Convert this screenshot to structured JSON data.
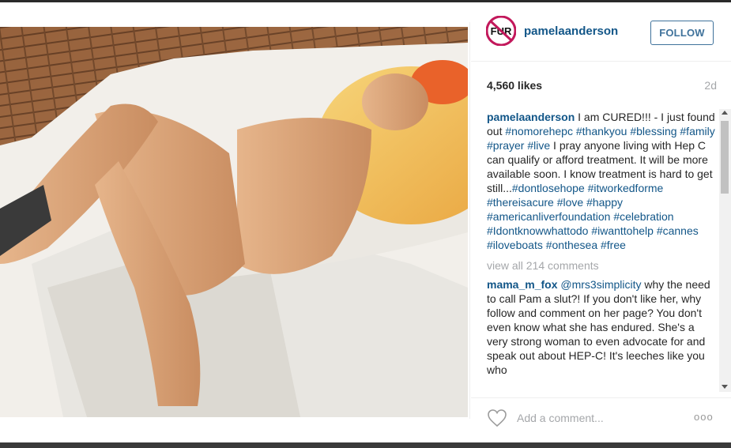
{
  "post": {
    "username": "pamelaanderson",
    "follow_label": "FOLLOW",
    "avatar_text": "FUR",
    "likes": "4,560 likes",
    "age": "2d",
    "caption_user": "pamelaanderson",
    "caption_text_1": " I am CURED!!! - I just found out ",
    "caption_tags_1": "#nomorehepc #thankyou #blessing #family #prayer #live",
    "caption_text_2": " I pray anyone living with Hep C can qualify or afford treatment. It will be more available soon. I know treatment is hard to get still...",
    "caption_tags_2": "#dontlosehope #itworkedforme #thereisacure #love #happy #americanliverfoundation #celebration #Idontknowwhattodo #iwanttohelp #cannes #iloveboats #onthesea #free",
    "view_all": "view all 214 comments",
    "comment_user": "mama_m_fox",
    "comment_mention": "@mrs3simplicity",
    "comment_text": " why the need to call Pam a slut?! If you don't like her, why follow and comment on her page? You don't even know what she has endured. She's a very strong woman to even advocate for and speak out about HEP-C! It's leeches like you who",
    "add_comment_placeholder": "Add a comment...",
    "more_label": "ooo"
  },
  "colors": {
    "link_blue": "#125688",
    "follow_blue": "#3f729b",
    "muted_gray": "#a5a7aa",
    "no_sign_magenta": "#c2185b"
  },
  "icons": {
    "avatar": "no-fur-logo",
    "heart": "heart-outline-icon",
    "more": "ellipsis-icon"
  }
}
